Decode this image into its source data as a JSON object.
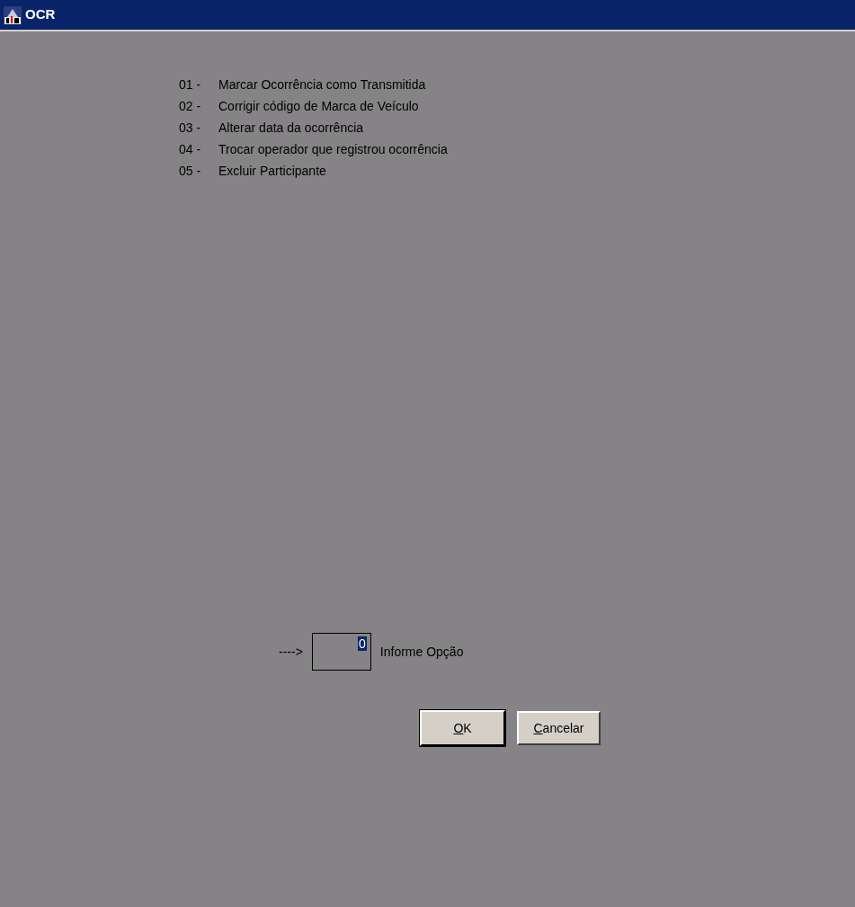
{
  "window": {
    "title": "OCR"
  },
  "options": [
    {
      "code": "01 -",
      "label": "Marcar Ocorrência como Transmitida"
    },
    {
      "code": "02 -",
      "label": "Corrigir código de Marca de Veículo"
    },
    {
      "code": "03 -",
      "label": "Alterar data da ocorrência"
    },
    {
      "code": "04 -",
      "label": "Trocar operador que registrou ocorrência"
    },
    {
      "code": "05 -",
      "label": "Excluir Participante"
    }
  ],
  "option_input": {
    "arrow": "---->",
    "value": "0",
    "label": "Informe Opção"
  },
  "buttons": [
    {
      "mnemonic": "O",
      "rest": "K",
      "default": true
    },
    {
      "mnemonic": "C",
      "rest": "ancelar",
      "default": false
    }
  ]
}
